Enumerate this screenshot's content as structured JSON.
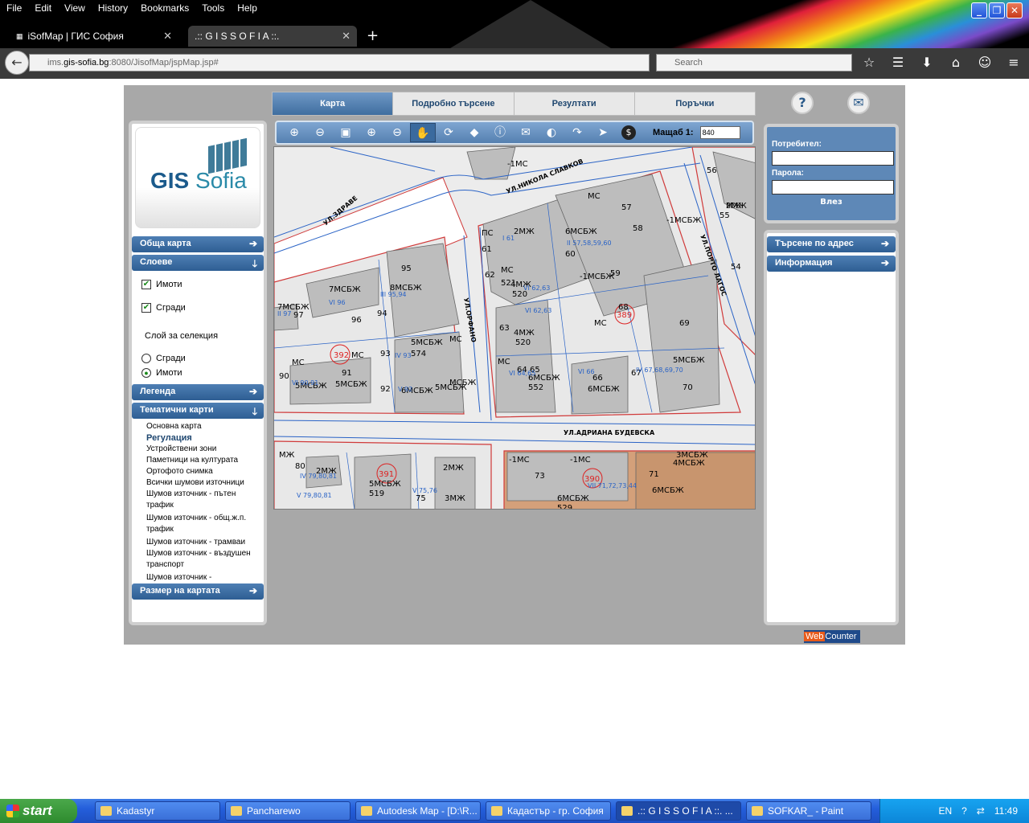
{
  "browser": {
    "menu": [
      "File",
      "Edit",
      "View",
      "History",
      "Bookmarks",
      "Tools",
      "Help"
    ],
    "tabs": [
      {
        "title": "iSofMap | ГИС София"
      },
      {
        "title": ".:: G I S S O F I A ::."
      }
    ],
    "url": {
      "host_prefix": "ims.",
      "host": "gis-sofia.bg",
      "path": ":8080/JisofMap/jspMap.jsp#"
    },
    "search_placeholder": "Search"
  },
  "app": {
    "nav": [
      "Карта",
      "Подробно търсене",
      "Резултати",
      "Поръчки"
    ],
    "help_label": "?",
    "toolbar": {
      "scale_label": "Мащаб 1:",
      "scale_value": "840"
    },
    "logo": {
      "word1": "GIS",
      "word2": "Sofia"
    },
    "left": {
      "general_map": "Обща карта",
      "layers": "Слоеве",
      "layer_checks": [
        "Имоти",
        "Сгради"
      ],
      "selection_title": "Слой за селекция",
      "selection_options": [
        "Сгради",
        "Имоти"
      ],
      "legend": "Легенда",
      "thematic": "Тематични карти",
      "thematic_items": [
        "Основна карта",
        "Регулация",
        "Устройствени зони",
        "Паметници на културата",
        "Ортофото снимка",
        "Всички шумови източници",
        "Шумов източник - пътен трафик",
        "Шумов източник - общ.ж.п. трафик",
        "Шумов източник - трамваи",
        "Шумов източник - въздушен транспорт",
        "Шумов източник - промишленост"
      ],
      "map_size": "Размер на картата"
    },
    "login": {
      "user_label": "Потребител:",
      "pass_label": "Парола:",
      "login_button": "Влез"
    },
    "right": {
      "address_search": "Търсене по адрес",
      "information": "Информация"
    },
    "webcounter": {
      "a": "Web",
      "b": "Counter"
    }
  },
  "map": {
    "streets": [
      "УЛ.НИКОЛА СЛАВКОВ",
      "УЛ.ЗДРАВЕ",
      "УЛ.ОРФАНО",
      "УЛ.ПОРТО ЛАГОС",
      "УЛ.АДРИАНА БУДЕВСКА"
    ],
    "labels": [
      "-1МС",
      "МС",
      "57",
      "58",
      "-1МСБЖ",
      "ПС",
      "2МЖ",
      "6МСБЖ",
      "61",
      "60",
      "62",
      "МС",
      "521",
      "4МЖ",
      "520",
      "59",
      "-1МСБЖ",
      "389",
      "68",
      "МС",
      "69",
      "63",
      "4МЖ",
      "520",
      "МС",
      "64",
      "65",
      "6МСБЖ",
      "552",
      "66",
      "6МСБЖ",
      "67",
      "5МСБЖ",
      "70",
      "95",
      "7МСБЖ",
      "8МСБЖ",
      "7МСБЖ",
      "97",
      "94",
      "96",
      "МС",
      "392",
      "МС",
      "93",
      "5МСБЖ",
      "574",
      "МС",
      "90",
      "91",
      "5МСБЖ",
      "5МСБЖ",
      "92",
      "6МСБЖ",
      "5МСБЖ",
      "МСБЖ",
      "МЖ",
      "56",
      "2МЖ",
      "55",
      "54",
      "МЖ",
      "80",
      "2МЖ",
      "391",
      "5МСБЖ",
      "519",
      "2МЖ",
      "75",
      "3МЖ",
      "-1МС",
      "-1МС",
      "73",
      "390",
      "71",
      "3МСБЖ",
      "4МСБЖ",
      "6МСБЖ",
      "6МСБЖ",
      "529"
    ],
    "lot_codes": [
      "I 61",
      "II 57,58,59,60",
      "VI 62,63",
      "VI 62,63",
      "VI 64,65",
      "VI 66",
      "IV 67,68,69,70",
      "VI 96",
      "III 95,94",
      "II 97",
      "VI 90,91",
      "IV 93",
      "V 92",
      "IV 79,80,81",
      "V 79,80,81",
      "V 75,76",
      "VII 71,72,73,44"
    ]
  },
  "taskbar": {
    "start": "start",
    "tasks": [
      "Kadastyr",
      "Pancharewo",
      "Autodesk Map - [D:\\R...",
      "Кадастър - гр. София",
      ".:: G I S S O F I A ::. ...",
      "SOFKAR_ - Paint"
    ],
    "lang": "EN",
    "time": "11:49"
  }
}
